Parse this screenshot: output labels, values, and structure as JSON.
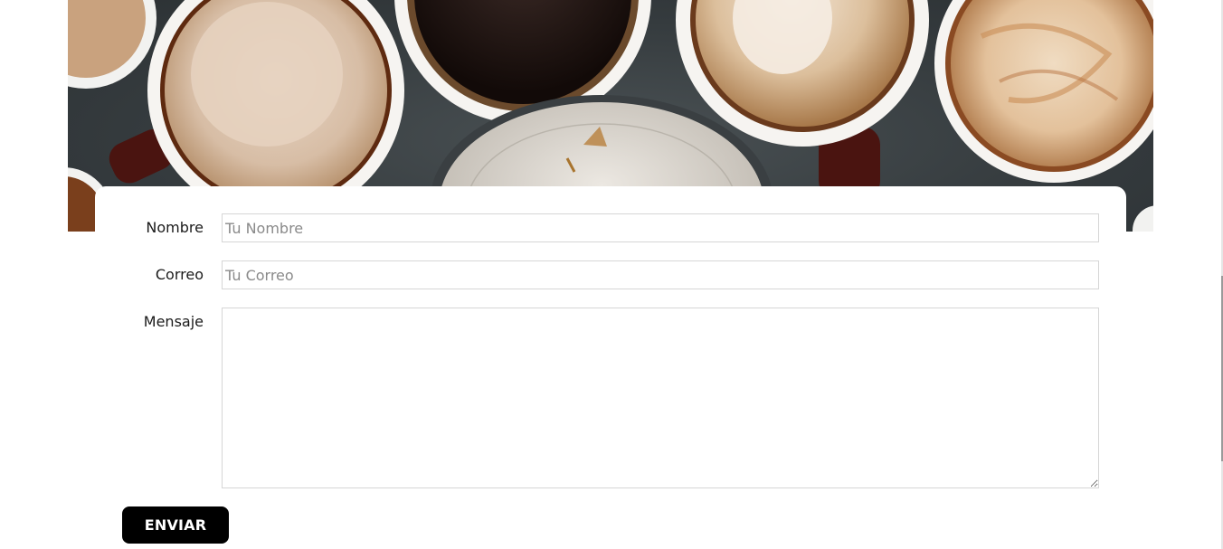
{
  "hero": {
    "image": "coffee-cups-overhead"
  },
  "form": {
    "nombre": {
      "label": "Nombre",
      "placeholder": "Tu Nombre",
      "value": ""
    },
    "correo": {
      "label": "Correo",
      "placeholder": "Tu Correo",
      "value": ""
    },
    "mensaje": {
      "label": "Mensaje",
      "placeholder": "",
      "value": ""
    },
    "submit_label": "ENVIAR"
  },
  "colors": {
    "button_bg": "#000000",
    "button_text": "#ffffff",
    "field_border": "#d6d6d6",
    "page_bg": "#ffffff"
  }
}
